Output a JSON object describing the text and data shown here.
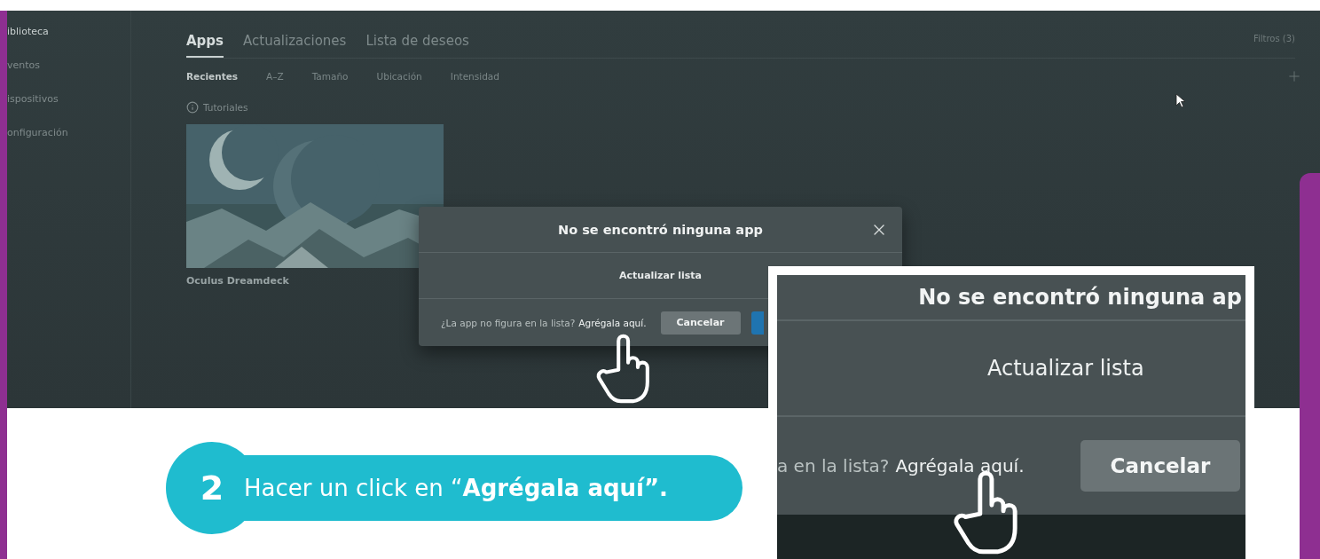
{
  "sidebar": {
    "items": [
      {
        "label": "iblioteca",
        "selected": true
      },
      {
        "label": "ventos",
        "selected": false
      },
      {
        "label": "ispositivos",
        "selected": false
      },
      {
        "label": "onfiguración",
        "selected": false
      }
    ]
  },
  "tabs": [
    {
      "label": "Apps",
      "selected": true
    },
    {
      "label": "Actualizaciones",
      "selected": false
    },
    {
      "label": "Lista de deseos",
      "selected": false
    }
  ],
  "filters": "Filtros (3)",
  "sort_options": [
    {
      "label": "Recientes",
      "selected": true
    },
    {
      "label": "A–Z",
      "selected": false
    },
    {
      "label": "Tamaño",
      "selected": false
    },
    {
      "label": "Ubicación",
      "selected": false
    },
    {
      "label": "Intensidad",
      "selected": false
    }
  ],
  "section": {
    "title": "Tutoriales"
  },
  "apps": [
    {
      "title": "Oculus Dreamdeck",
      "kind": "picture"
    }
  ],
  "dialog": {
    "title": "No se encontró ninguna app",
    "refresh": "Actualizar lista",
    "question": "¿La app no figura en la lista?",
    "link": "Agrégala aquí.",
    "cancel": "Cancelar"
  },
  "callout": {
    "step": "2",
    "text": "Hacer un click en “**Agrégala aquí”.**"
  },
  "zoom_inset": {
    "title": "No se encontró ninguna ap",
    "refresh": "Actualizar lista",
    "question": "a en la lista?",
    "link": "Agrégala aquí.",
    "cancel": "Cancelar"
  }
}
